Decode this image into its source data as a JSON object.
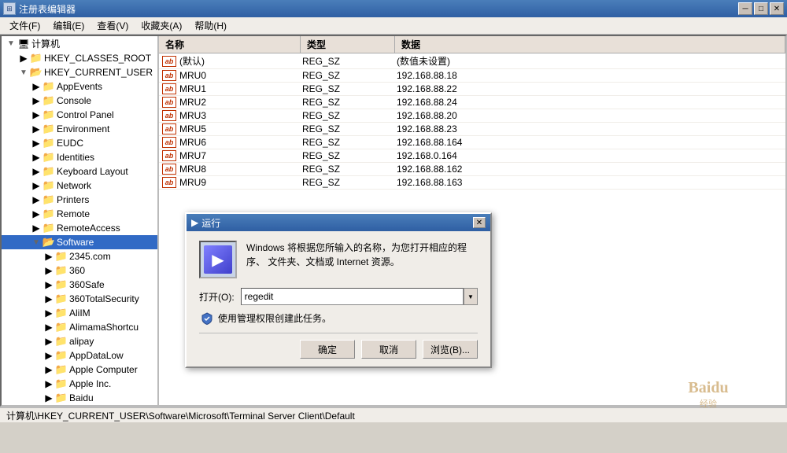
{
  "titleBar": {
    "title": "注册表编辑器",
    "iconText": "⊞",
    "buttons": {
      "minimize": "─",
      "maximize": "□",
      "close": "✕"
    }
  },
  "menuBar": {
    "items": [
      "文件(F)",
      "编辑(E)",
      "查看(V)",
      "收藏夹(A)",
      "帮助(H)"
    ]
  },
  "tree": {
    "items": [
      {
        "level": 0,
        "expanded": true,
        "label": "计算机",
        "icon": "💻"
      },
      {
        "level": 1,
        "expanded": false,
        "label": "HKEY_CLASSES_ROOT",
        "icon": "📁"
      },
      {
        "level": 1,
        "expanded": true,
        "label": "HKEY_CURRENT_USER",
        "icon": "📂"
      },
      {
        "level": 2,
        "expanded": false,
        "label": "AppEvents",
        "icon": "📁"
      },
      {
        "level": 2,
        "expanded": false,
        "label": "Console",
        "icon": "📁"
      },
      {
        "level": 2,
        "expanded": false,
        "label": "Control Panel",
        "icon": "📁"
      },
      {
        "level": 2,
        "expanded": false,
        "label": "Environment",
        "icon": "📁"
      },
      {
        "level": 2,
        "expanded": false,
        "label": "EUDC",
        "icon": "📁"
      },
      {
        "level": 2,
        "expanded": false,
        "label": "Identities",
        "icon": "📁"
      },
      {
        "level": 2,
        "expanded": false,
        "label": "Keyboard Layout",
        "icon": "📁"
      },
      {
        "level": 2,
        "expanded": false,
        "label": "Network",
        "icon": "📁"
      },
      {
        "level": 2,
        "expanded": false,
        "label": "Printers",
        "icon": "📁"
      },
      {
        "level": 2,
        "expanded": false,
        "label": "Remote",
        "icon": "📁"
      },
      {
        "level": 2,
        "expanded": false,
        "label": "RemoteAccess",
        "icon": "📁"
      },
      {
        "level": 2,
        "expanded": true,
        "label": "Software",
        "icon": "📂"
      },
      {
        "level": 3,
        "expanded": false,
        "label": "2345.com",
        "icon": "📁"
      },
      {
        "level": 3,
        "expanded": false,
        "label": "360",
        "icon": "📁"
      },
      {
        "level": 3,
        "expanded": false,
        "label": "360Safe",
        "icon": "📁"
      },
      {
        "level": 3,
        "expanded": false,
        "label": "360TotalSecurity",
        "icon": "📁"
      },
      {
        "level": 3,
        "expanded": false,
        "label": "AliIM",
        "icon": "📁"
      },
      {
        "level": 3,
        "expanded": false,
        "label": "AlimamaShortcu",
        "icon": "📁"
      },
      {
        "level": 3,
        "expanded": false,
        "label": "alipay",
        "icon": "📁"
      },
      {
        "level": 3,
        "expanded": false,
        "label": "AppDataLow",
        "icon": "📁"
      },
      {
        "level": 3,
        "expanded": false,
        "label": "Apple Computer",
        "icon": "📁"
      },
      {
        "level": 3,
        "expanded": false,
        "label": "Apple Inc.",
        "icon": "📁"
      },
      {
        "level": 3,
        "expanded": false,
        "label": "Baidu",
        "icon": "📁"
      }
    ]
  },
  "valuesPanel": {
    "headers": [
      "名称",
      "类型",
      "数据"
    ],
    "rows": [
      {
        "icon": "ab",
        "name": "(默认)",
        "type": "REG_SZ",
        "data": "(数值未设置)"
      },
      {
        "icon": "ab",
        "name": "MRU0",
        "type": "REG_SZ",
        "data": "192.168.88.18"
      },
      {
        "icon": "ab",
        "name": "MRU1",
        "type": "REG_SZ",
        "data": "192.168.88.22"
      },
      {
        "icon": "ab",
        "name": "MRU2",
        "type": "REG_SZ",
        "data": "192.168.88.24"
      },
      {
        "icon": "ab",
        "name": "MRU3",
        "type": "REG_SZ",
        "data": "192.168.88.20"
      },
      {
        "icon": "ab",
        "name": "MRU5",
        "type": "REG_SZ",
        "data": "192.168.88.23"
      },
      {
        "icon": "ab",
        "name": "MRU6",
        "type": "REG_SZ",
        "data": "192.168.88.164"
      },
      {
        "icon": "ab",
        "name": "MRU7",
        "type": "REG_SZ",
        "data": "192.168.0.164"
      },
      {
        "icon": "ab",
        "name": "MRU8",
        "type": "REG_SZ",
        "data": "192.168.88.162"
      },
      {
        "icon": "ab",
        "name": "MRU9",
        "type": "REG_SZ",
        "data": "192.168.88.163"
      }
    ]
  },
  "runDialog": {
    "title": "运行",
    "closeBtn": "✕",
    "description": "Windows 将根据您所输入的名称，为您打开相应的程序、\n文件夹、文档或 Internet 资源。",
    "inputLabel": "打开(O):",
    "inputValue": "regedit",
    "shieldText": "使用管理权限创建此任务。",
    "buttons": {
      "ok": "确定",
      "cancel": "取消",
      "browse": "浏览(B)..."
    }
  },
  "statusBar": {
    "text": "计算机\\HKEY_CURRENT_USER\\Software\\Microsoft\\Terminal Server Client\\Default"
  }
}
